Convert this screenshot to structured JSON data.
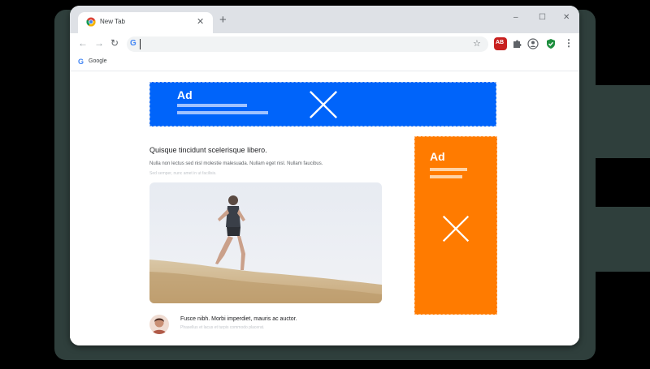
{
  "tab": {
    "title": "New Tab",
    "close_icon": "close-icon",
    "favicon": "chrome-logo-icon"
  },
  "new_tab_symbol": "+",
  "window_controls": {
    "minimize": "–",
    "maximize": "☐",
    "close": "✕"
  },
  "nav": {
    "back": "←",
    "forward": "→",
    "reload": "↻"
  },
  "omnibox": {
    "google_glyph": "G",
    "value": "",
    "star": "☆"
  },
  "extensions": {
    "adblock_label": "AB",
    "puzzle": "puzzle-icon",
    "profile": "profile-icon",
    "shield": "shield-check-icon",
    "menu": "⋮"
  },
  "bookmarks": {
    "google_glyph": "G",
    "label": "Google"
  },
  "ads": {
    "top": {
      "label": "Ad"
    },
    "side": {
      "label": "Ad"
    }
  },
  "article": {
    "headline": "Quisque tincidunt scelerisque libero.",
    "body": "Nulla non lectus sed nisl molestie malesuada. Nullam eget nisl. Nullam faucibus.",
    "meta": "Sed semper, nunc amet in ut facilisis.",
    "caption": "Fusce nibh. Morbi imperdiet, mauris ac auctor.",
    "caption_sub": "Phasellus et lacus et turpis commodo placerat."
  },
  "colors": {
    "ad_blue": "#0064fa",
    "ad_orange": "#ff7b00",
    "tabstrip": "#dee1e6",
    "adblock_red": "#c8201f",
    "shield_green": "#1e8e3e"
  }
}
